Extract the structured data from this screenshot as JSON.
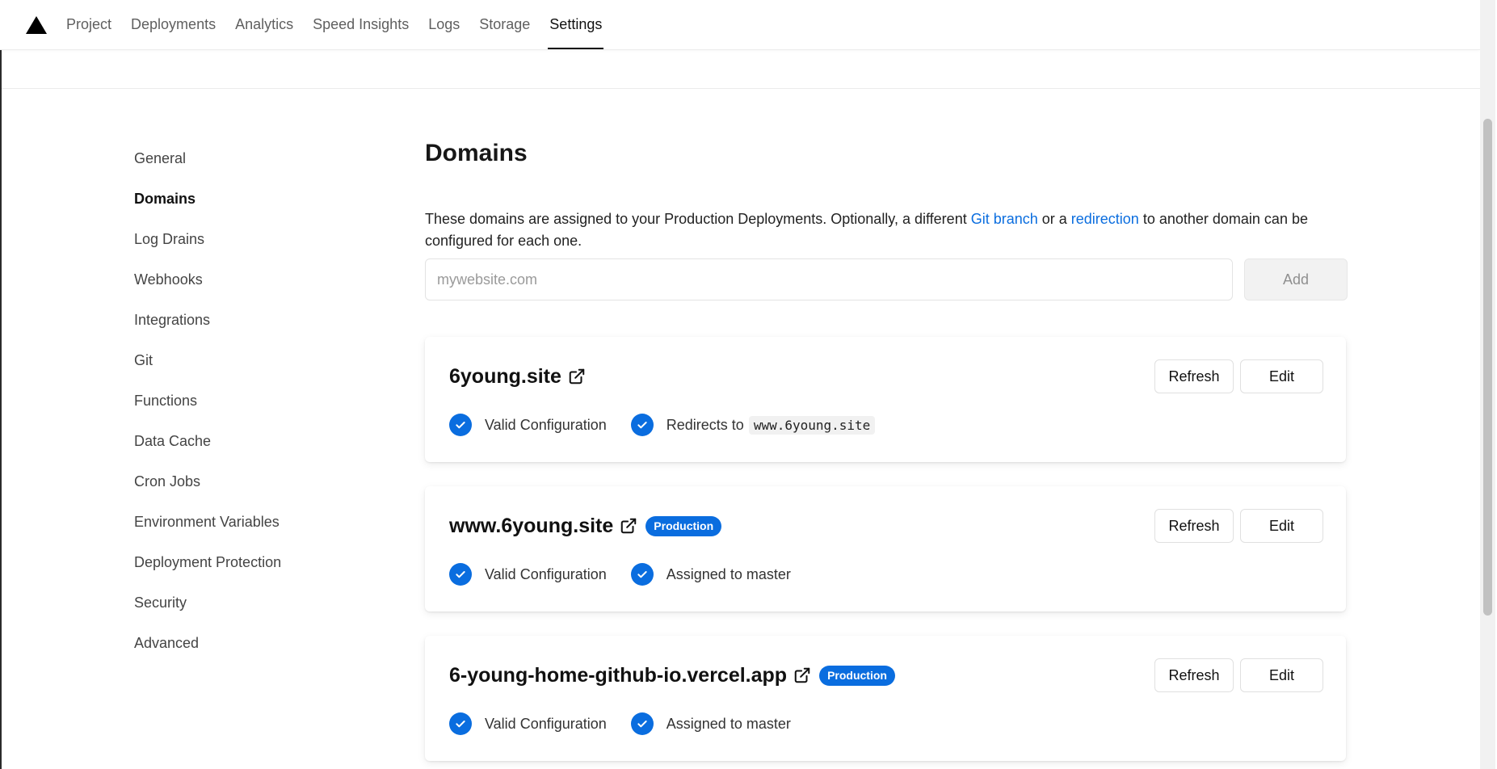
{
  "nav": {
    "tabs": [
      "Project",
      "Deployments",
      "Analytics",
      "Speed Insights",
      "Logs",
      "Storage",
      "Settings"
    ],
    "active": "Settings"
  },
  "sidebar": {
    "items": [
      "General",
      "Domains",
      "Log Drains",
      "Webhooks",
      "Integrations",
      "Git",
      "Functions",
      "Data Cache",
      "Cron Jobs",
      "Environment Variables",
      "Deployment Protection",
      "Security",
      "Advanced"
    ],
    "active": "Domains"
  },
  "main": {
    "title": "Domains",
    "description_prefix": "These domains are assigned to your Production Deployments. Optionally, a different ",
    "git_branch_link": "Git branch",
    "description_mid": " or a ",
    "redirection_link": "redirection",
    "description_suffix": " to another domain can be configured for each one.",
    "input_placeholder": "mywebsite.com",
    "add_label": "Add"
  },
  "domains": [
    {
      "name": "6young.site",
      "badge": "",
      "status1": "Valid Configuration",
      "status2": "Redirects to",
      "status2_code": "www.6young.site",
      "refresh": "Refresh",
      "edit": "Edit"
    },
    {
      "name": "www.6young.site",
      "badge": "Production",
      "status1": "Valid Configuration",
      "status2": "Assigned to master",
      "status2_code": "",
      "refresh": "Refresh",
      "edit": "Edit"
    },
    {
      "name": "6-young-home-github-io.vercel.app",
      "badge": "Production",
      "status1": "Valid Configuration",
      "status2": "Assigned to master",
      "status2_code": "",
      "refresh": "Refresh",
      "edit": "Edit"
    }
  ],
  "colors": {
    "accent": "#0a6ddf",
    "text": "#171717"
  }
}
